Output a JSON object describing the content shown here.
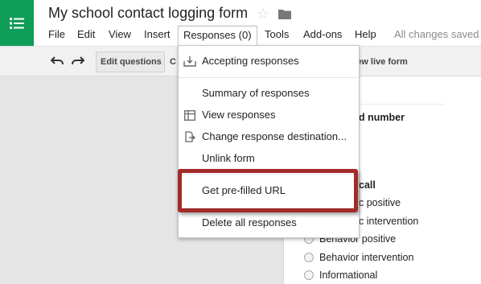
{
  "app": {
    "logo_icon": "forms-list-icon",
    "brand_color": "#0f9d58"
  },
  "document": {
    "title": "My school contact logging form"
  },
  "menubar": {
    "items": [
      "File",
      "Edit",
      "View",
      "Insert",
      "Responses (0)",
      "Tools",
      "Add-ons",
      "Help"
    ],
    "active": "Responses (0)",
    "save_status": "All changes saved"
  },
  "toolbar": {
    "edit_questions": "Edit questions",
    "edit_questions_truncated_next": "C",
    "view_live_form": "View live form"
  },
  "responses_menu": {
    "items": [
      {
        "label": "Accepting responses",
        "icon": "inbox-download-icon"
      },
      {
        "label": "Summary of responses",
        "icon": ""
      },
      {
        "label": "View responses",
        "icon": "table-icon"
      },
      {
        "label": "Change response destination...",
        "icon": "destination-icon"
      },
      {
        "label": "Unlink form",
        "icon": ""
      },
      {
        "label": "Get pre-filled URL",
        "icon": ""
      },
      {
        "label": "Delete all responses",
        "icon": ""
      }
    ],
    "highlighted": "Get pre-filled URL",
    "highlight_color": "#a32a2a"
  },
  "form_preview": {
    "question_1_partial": "d number",
    "question_2_partial": "call",
    "options": [
      "c positive",
      "c intervention",
      "Behavior positive",
      "Behavior intervention",
      "Informational"
    ]
  }
}
